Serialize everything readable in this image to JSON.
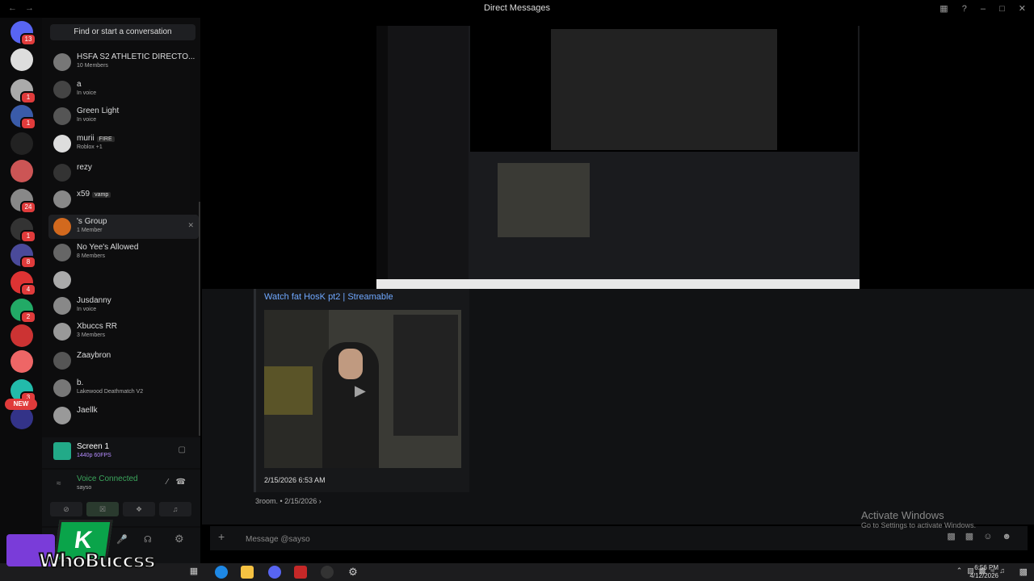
{
  "window": {
    "title": "Direct Messages"
  },
  "search": {
    "placeholder": "Find or start a conversation"
  },
  "servers": [
    {
      "color": "#5865f2",
      "badge": "13"
    },
    {
      "color": "#ddd",
      "badge": ""
    },
    {
      "color": "#aaa",
      "badge": "1"
    },
    {
      "color": "#3a5ba9",
      "badge": "1"
    },
    {
      "color": "#222",
      "badge": ""
    },
    {
      "color": "#c55",
      "badge": ""
    },
    {
      "color": "#888",
      "badge": "24"
    },
    {
      "color": "#333",
      "badge": "1"
    },
    {
      "color": "#4a4a9a",
      "badge": "8"
    },
    {
      "color": "#d33",
      "badge": "4"
    },
    {
      "color": "#2a6",
      "badge": "2"
    },
    {
      "color": "#c33",
      "badge": ""
    },
    {
      "color": "#e66",
      "badge": ""
    },
    {
      "color": "#2ba",
      "badge": "3"
    },
    {
      "color": "#338",
      "badge": ""
    }
  ],
  "new_badge": "NEW",
  "dms": [
    {
      "name": "HSFA S2 ATHLETIC DIRECTO...",
      "sub": "10 Members",
      "tag": ""
    },
    {
      "name": "a",
      "sub": "In voice",
      "tag": ""
    },
    {
      "name": "Green Light",
      "sub": "In voice",
      "tag": ""
    },
    {
      "name": "murii",
      "sub": "Roblox +1",
      "tag": "FIRE"
    },
    {
      "name": "rezy",
      "sub": "",
      "tag": ""
    },
    {
      "name": "x59",
      "sub": "",
      "tag": "vamp"
    },
    {
      "name": "'s Group",
      "sub": "1 Member",
      "tag": ""
    },
    {
      "name": "No Yee's Allowed",
      "sub": "8 Members",
      "tag": ""
    },
    {
      "name": "",
      "sub": "",
      "tag": ""
    },
    {
      "name": "Jusdanny",
      "sub": "In voice",
      "tag": ""
    },
    {
      "name": "Xbuccs RR",
      "sub": "3 Members",
      "tag": ""
    },
    {
      "name": "Zaaybron",
      "sub": "",
      "tag": ""
    },
    {
      "name": "b.",
      "sub": "Lakewood Deathmatch V2",
      "tag": ""
    },
    {
      "name": "Jaellk",
      "sub": "",
      "tag": ""
    }
  ],
  "screen_share": {
    "title": "Screen 1",
    "sub": "1440p 60FPS"
  },
  "voice": {
    "status": "Voice Connected",
    "user": "sayso"
  },
  "embed": {
    "link": "Watch fat HosK pt2 | Streamable",
    "timestamp": "2/15/2026 6:53 AM",
    "reply": "3room. • 2/15/2026 ›"
  },
  "composer": {
    "placeholder": "Message @sayso"
  },
  "activate": {
    "line1": "Activate Windows",
    "line2": "Go to Settings to activate Windows."
  },
  "clock": {
    "time": "6:56 PM",
    "date": "4/12/2026"
  },
  "watermark": {
    "text": "WhoBuccss",
    "logo_letter": "K"
  },
  "colors": {
    "accent": "#5865f2",
    "voice_green": "#3ba55c",
    "link": "#6fa8ff",
    "danger": "#e03b3b"
  }
}
